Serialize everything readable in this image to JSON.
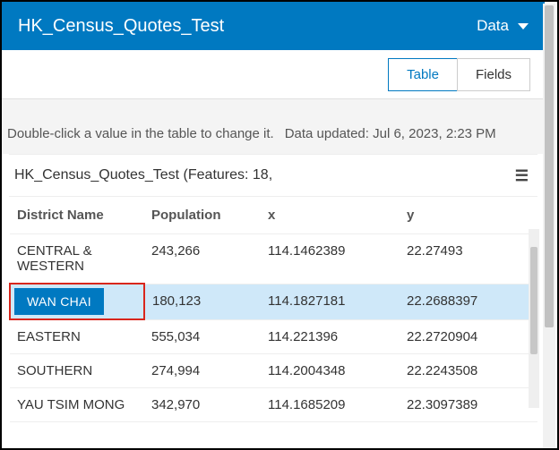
{
  "header": {
    "title": "HK_Census_Quotes_Test",
    "menu_label": "Data"
  },
  "tabs": {
    "table": "Table",
    "fields": "Fields"
  },
  "hint": {
    "instruction": "Double-click a value in the table to change it.",
    "updated": "Data updated: Jul 6, 2023, 2:23 PM"
  },
  "table": {
    "title": "HK_Census_Quotes_Test (Features: 18,",
    "columns": {
      "c1": "District Name",
      "c2": "Population",
      "c3": "x",
      "c4": "y"
    },
    "rows": [
      {
        "name": "CENTRAL & WESTERN",
        "pop": "243,266",
        "x": "114.1462389",
        "y": "22.27493"
      },
      {
        "name": "WAN CHAI",
        "pop": "180,123",
        "x": "114.1827181",
        "y": "22.2688397"
      },
      {
        "name": "EASTERN",
        "pop": "555,034",
        "x": "114.221396",
        "y": "22.2720904"
      },
      {
        "name": "SOUTHERN",
        "pop": "274,994",
        "x": "114.2004348",
        "y": "22.2243508"
      },
      {
        "name": "YAU TSIM MONG",
        "pop": "342,970",
        "x": "114.1685209",
        "y": "22.3097389"
      }
    ]
  }
}
